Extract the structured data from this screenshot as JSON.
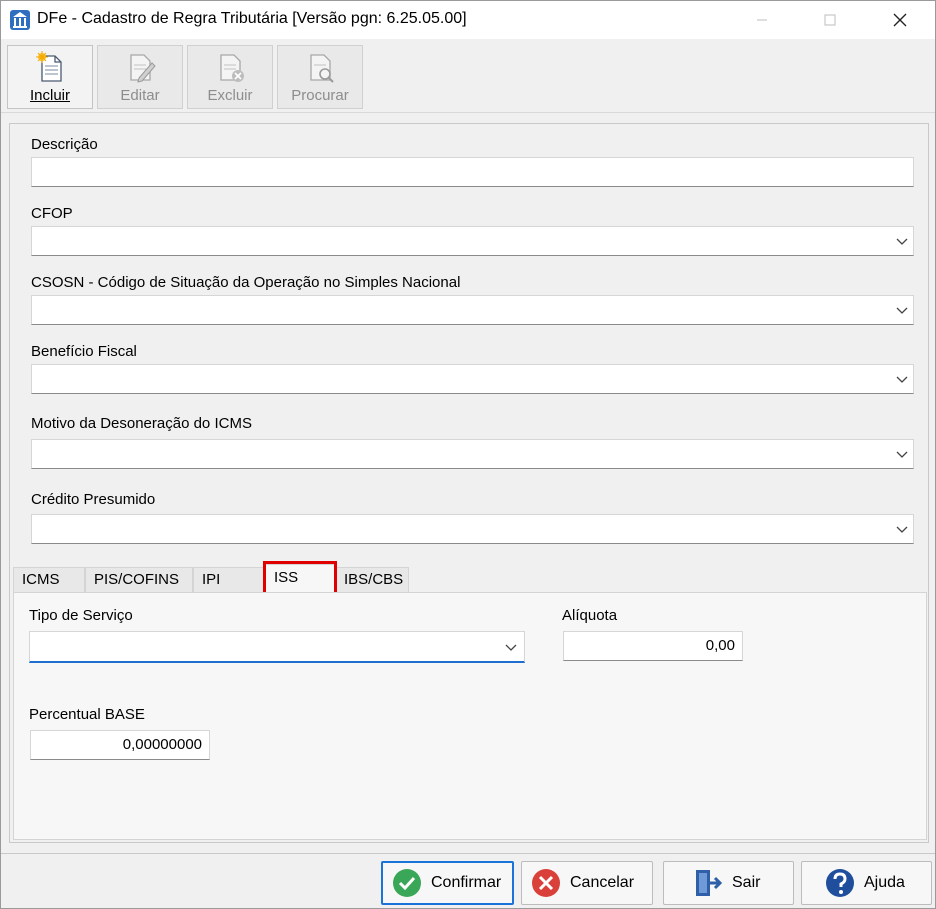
{
  "window": {
    "title": "DFe - Cadastro de Regra Tributária [Versão pgn: 6.25.05.00]"
  },
  "toolbar": {
    "incluir": "Incluir",
    "editar": "Editar",
    "excluir": "Excluir",
    "procurar": "Procurar"
  },
  "form": {
    "descricao_label": "Descrição",
    "descricao_value": "",
    "cfop_label": "CFOP",
    "cfop_value": "",
    "csosn_label": "CSOSN - Código de Situação da Operação no Simples Nacional",
    "csosn_value": "",
    "beneficio_label": "Benefício Fiscal",
    "beneficio_value": "",
    "motivo_label": "Motivo da Desoneração do ICMS",
    "motivo_value": "",
    "credito_label": "Crédito Presumido",
    "credito_value": ""
  },
  "tabs": [
    {
      "label": "ICMS"
    },
    {
      "label": "PIS/COFINS"
    },
    {
      "label": "IPI"
    },
    {
      "label": "ISS"
    },
    {
      "label": "IBS/CBS"
    }
  ],
  "selected_tab": "ISS",
  "iss": {
    "tipo_servico_label": "Tipo de Serviço",
    "tipo_servico_value": "",
    "aliquota_label": "Alíquota",
    "aliquota_value": "0,00",
    "percentual_label": "Percentual BASE",
    "percentual_value": "0,00000000"
  },
  "buttons": {
    "confirmar": "Confirmar",
    "cancelar": "Cancelar",
    "sair": "Sair",
    "ajuda": "Ajuda"
  },
  "colors": {
    "accent": "#1a73d9",
    "highlight": "#e00000",
    "confirm": "#3aa657",
    "cancel": "#d9403a",
    "help": "#1f4e9c"
  }
}
